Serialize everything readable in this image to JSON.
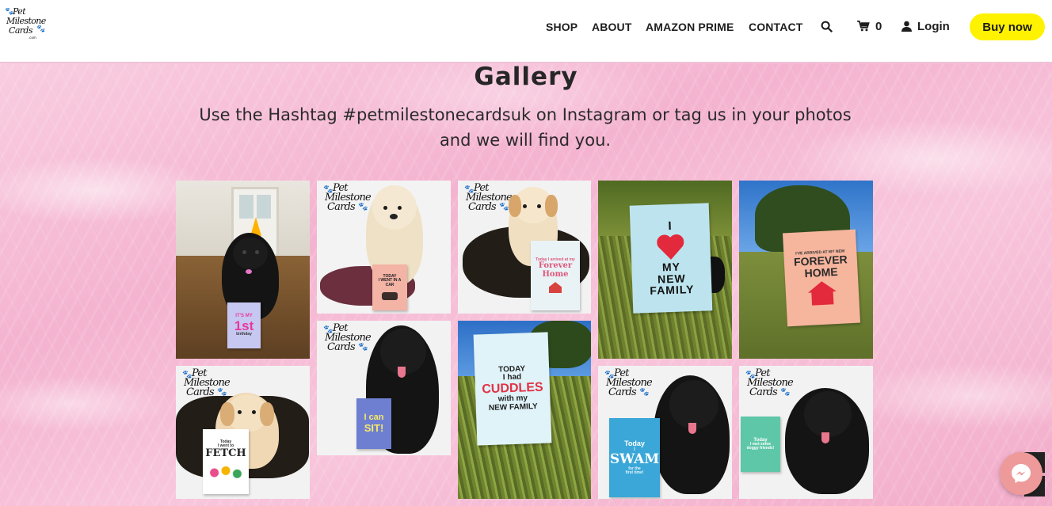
{
  "header": {
    "logo_text": [
      "Pet",
      "Milestone",
      "Cards"
    ],
    "logo_suffix": ".com",
    "nav": [
      "SHOP",
      "ABOUT",
      "AMAZON PRIME",
      "CONTACT"
    ],
    "cart_count": "0",
    "login_label": "Login",
    "buy_label": "Buy now",
    "buy_color": "#fff200"
  },
  "hero": {
    "title": "Gallery",
    "subtitle_line1": "Use the Hashtag #petmilestonecardsuk on Instagram or tag us in your photos",
    "subtitle_line2": "and we will find you."
  },
  "watermark": [
    "Pet",
    "Milestone",
    "Cards"
  ],
  "cards": {
    "c1": [
      "IT'S MY",
      "1st",
      "birthday"
    ],
    "c2": [
      "TODAY",
      "I WENT IN A CAR"
    ],
    "c3": [
      "Today I arrived at my",
      "Forever Home"
    ],
    "c4": [
      "I",
      "MY",
      "NEW",
      "FAMILY"
    ],
    "c5": [
      "I'VE ARRIVED AT MY NEW",
      "FOREVER",
      "HOME"
    ],
    "c6": [
      "Today",
      "I went to",
      "FETCH"
    ],
    "c7": [
      "I can",
      "SIT!"
    ],
    "c8": [
      "TODAY",
      "I had",
      "CUDDLES",
      "with my",
      "NEW FAMILY"
    ],
    "c9": [
      "Today",
      "I",
      "SWAM",
      "for the",
      "first time!"
    ],
    "c10": [
      "Today",
      "I met some",
      "doggy friends!"
    ]
  },
  "icons": {
    "search": "search-icon",
    "cart": "cart-icon",
    "user": "user-icon",
    "messenger": "messenger-icon"
  }
}
